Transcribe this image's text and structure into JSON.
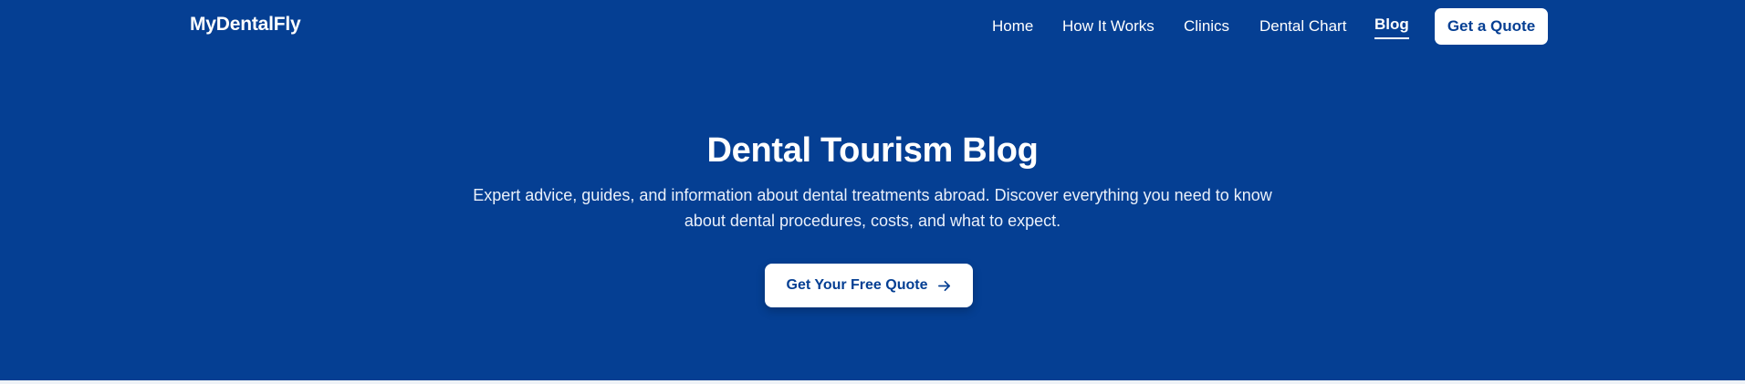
{
  "brand": {
    "name": "MyDentalFly"
  },
  "nav": {
    "items": [
      {
        "label": "Home"
      },
      {
        "label": "How It Works"
      },
      {
        "label": "Clinics"
      },
      {
        "label": "Dental Chart"
      },
      {
        "label": "Blog",
        "active": true
      }
    ],
    "quote_button_label": "Get a Quote"
  },
  "hero": {
    "title": "Dental Tourism Blog",
    "subtitle": "Expert advice, guides, and information about dental treatments abroad. Discover everything you need to know about dental procedures, costs, and what to expect.",
    "cta_label": "Get Your Free Quote",
    "cta_icon": "arrow-right-icon"
  },
  "colors": {
    "background": "#053f93",
    "button_background": "#ffffff",
    "button_text": "#053f93",
    "text": "#ffffff"
  }
}
